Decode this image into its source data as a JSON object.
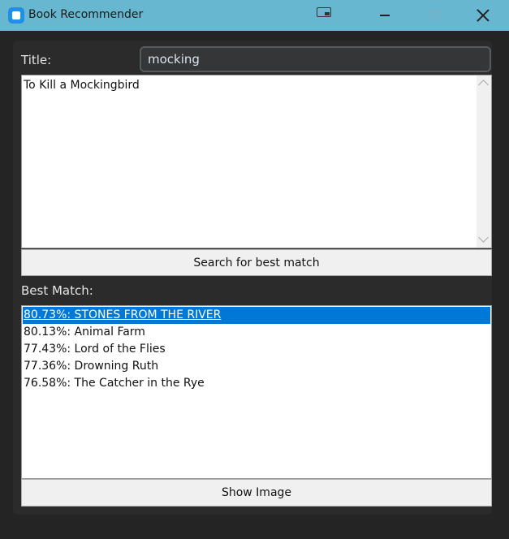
{
  "window": {
    "title": "Book Recommender"
  },
  "form": {
    "title_label": "Title:",
    "title_value": "mocking",
    "results_text": "To Kill a Mockingbird",
    "search_button": "Search for best match",
    "best_match_label": "Best Match:",
    "show_image_button": "Show Image"
  },
  "matches": [
    {
      "label": "80.73%: STONES FROM THE RIVER",
      "selected": true
    },
    {
      "label": "80.13%: Animal Farm",
      "selected": false
    },
    {
      "label": "77.43%: Lord of the Flies",
      "selected": false
    },
    {
      "label": "77.36%: Drowning Ruth",
      "selected": false
    },
    {
      "label": "76.58%: The Catcher in the Rye",
      "selected": false
    }
  ],
  "colors": {
    "titlebar": "#66b7cf",
    "background": "#242424",
    "selection": "#0078d7"
  }
}
